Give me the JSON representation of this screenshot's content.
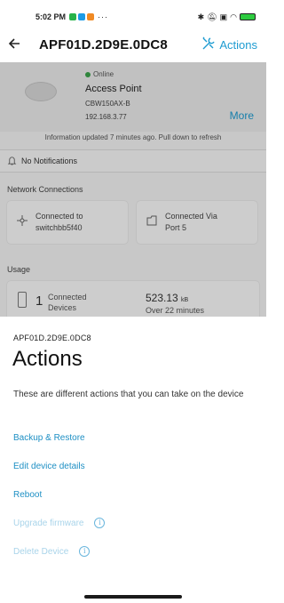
{
  "status_bar": {
    "time": "5:02 PM",
    "dots": "···",
    "battery_level": ""
  },
  "app_bar": {
    "title": "APF01D.2D9E.0DC8",
    "actions_label": "Actions",
    "back_icon": "arrow-left"
  },
  "device": {
    "status": "Online",
    "name": "Access Point",
    "model": "CBW150AX-B",
    "ip": "192.168.3.77",
    "more_label": "More",
    "info_line": "Information updated 7 minutes ago. Pull down to refresh"
  },
  "notifications": {
    "label": "No Notifications"
  },
  "network": {
    "section_label": "Network Connections",
    "connected_to_label": "Connected to",
    "connected_to_value": "switchbb5f40",
    "connected_via_label": "Connected Via",
    "connected_via_value": "Port 5"
  },
  "usage": {
    "section_label": "Usage",
    "devices_count": "1",
    "devices_label_line1": "Connected",
    "devices_label_line2": "Devices",
    "data_value": "523.13",
    "data_unit": "kB",
    "data_period": "Over 22 minutes"
  },
  "sheet": {
    "subtitle": "APF01D.2D9E.0DC8",
    "title": "Actions",
    "description": "These are different actions that you can take on the device",
    "options": [
      {
        "label": "Backup & Restore",
        "enabled": true
      },
      {
        "label": "Edit device details",
        "enabled": true
      },
      {
        "label": "Reboot",
        "enabled": true
      },
      {
        "label": "Upgrade firmware",
        "enabled": false
      },
      {
        "label": "Delete Device",
        "enabled": false
      }
    ],
    "info_glyph": "i"
  },
  "colors": {
    "accent": "#1d9bd1",
    "accent_disabled": "#a9d4ea",
    "online": "#3aa34a"
  }
}
